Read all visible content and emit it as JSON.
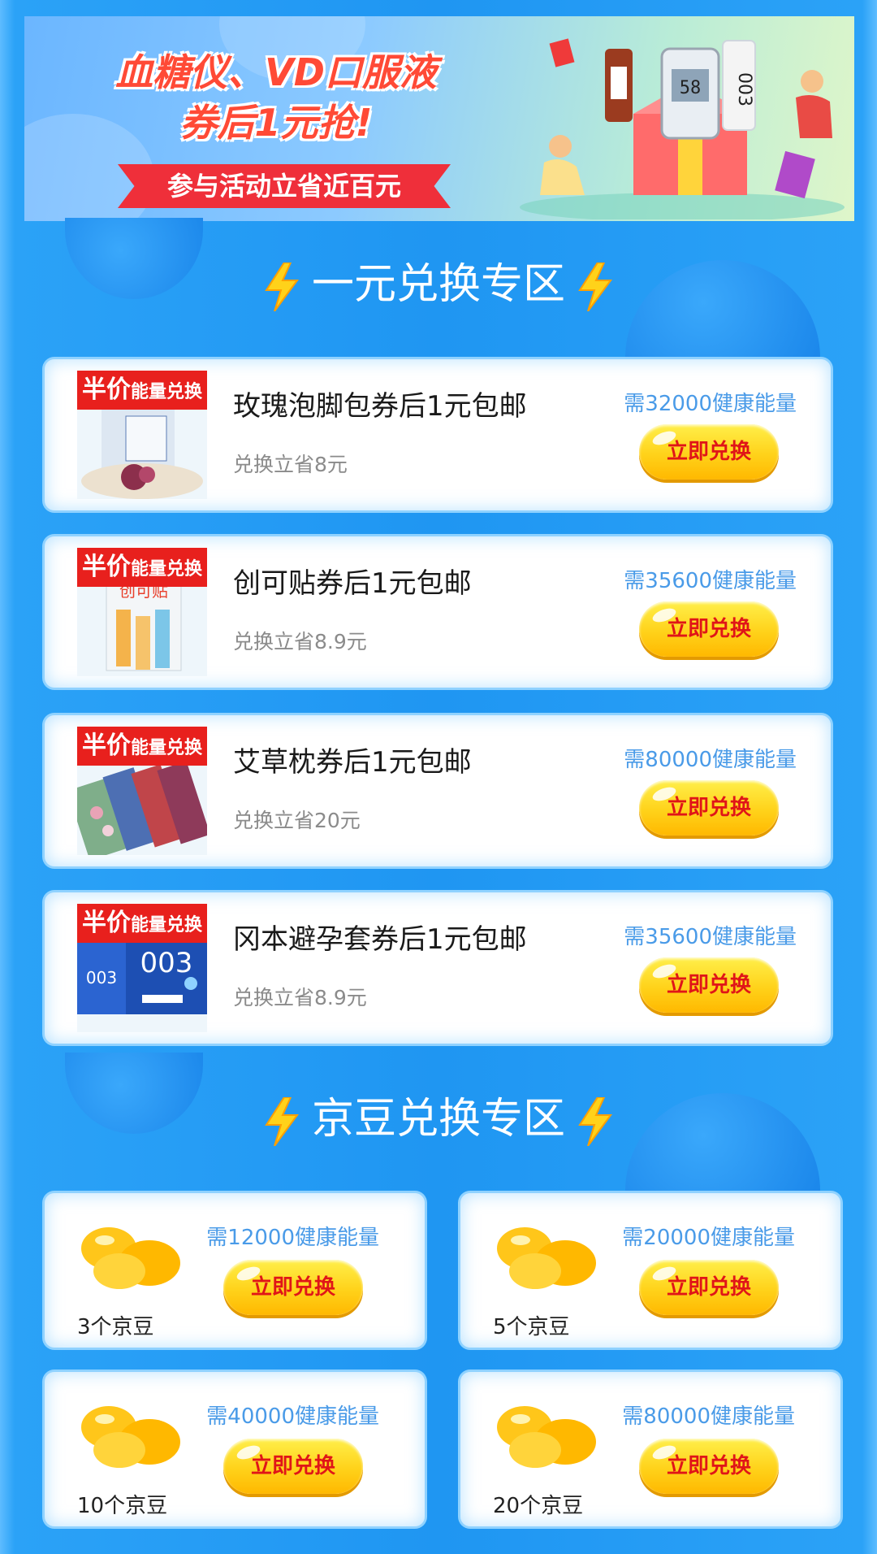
{
  "banner": {
    "title_line1": "血糖仪、VD口服液",
    "title_line2": "券后1元抢!",
    "ribbon": "参与活动立省近百元"
  },
  "section1": {
    "title": "一元兑换专区"
  },
  "products": [
    {
      "name": "玫瑰泡脚包券后1元包邮",
      "save": "兑换立省8元",
      "need": "需32000健康能量",
      "button": "立即兑换",
      "tag_big": "半价",
      "tag_small": "能量兑换"
    },
    {
      "name": "创可贴券后1元包邮",
      "save": "兑换立省8.9元",
      "need": "需35600健康能量",
      "button": "立即兑换",
      "tag_big": "半价",
      "tag_small": "能量兑换"
    },
    {
      "name": "艾草枕券后1元包邮",
      "save": "兑换立省20元",
      "need": "需80000健康能量",
      "button": "立即兑换",
      "tag_big": "半价",
      "tag_small": "能量兑换"
    },
    {
      "name": "冈本避孕套券后1元包邮",
      "save": "兑换立省8.9元",
      "need": "需35600健康能量",
      "button": "立即兑换",
      "tag_big": "半价",
      "tag_small": "能量兑换"
    }
  ],
  "section2": {
    "title": "京豆兑换专区"
  },
  "beans": [
    {
      "count": "3个京豆",
      "need": "需12000健康能量",
      "button": "立即兑换"
    },
    {
      "count": "5个京豆",
      "need": "需20000健康能量",
      "button": "立即兑换"
    },
    {
      "count": "10个京豆",
      "need": "需40000健康能量",
      "button": "立即兑换"
    },
    {
      "count": "20个京豆",
      "need": "需80000健康能量",
      "button": "立即兑换"
    }
  ],
  "colors": {
    "accent_red": "#e01518",
    "need_blue": "#4a9be8",
    "background_blue": "#2e9ff6",
    "button_yellow": "#ffd21a"
  }
}
